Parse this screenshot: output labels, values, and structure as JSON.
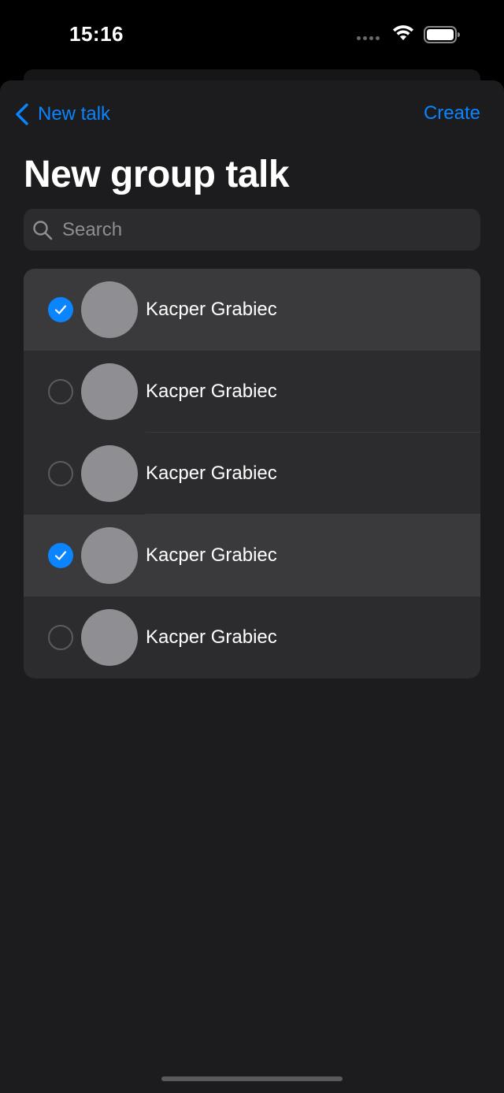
{
  "status_bar": {
    "time": "15:16"
  },
  "nav": {
    "back_label": "New talk",
    "create_label": "Create"
  },
  "title": "New group talk",
  "search": {
    "placeholder": "Search"
  },
  "contacts": [
    {
      "name": "Kacper Grabiec",
      "selected": true
    },
    {
      "name": "Kacper Grabiec",
      "selected": false
    },
    {
      "name": "Kacper Grabiec",
      "selected": false
    },
    {
      "name": "Kacper Grabiec",
      "selected": true
    },
    {
      "name": "Kacper Grabiec",
      "selected": false
    }
  ],
  "colors": {
    "accent": "#0a84ff",
    "background": "#1c1c1e",
    "list_background": "#2c2c2e",
    "selected_row": "#3a3a3c",
    "avatar": "#8e8e93"
  },
  "icons": {
    "back": "chevron-left-icon",
    "search": "magnifying-glass-icon",
    "check": "checkmark-icon",
    "wifi": "wifi-icon",
    "battery": "battery-icon",
    "signal": "signal-dots-icon"
  }
}
